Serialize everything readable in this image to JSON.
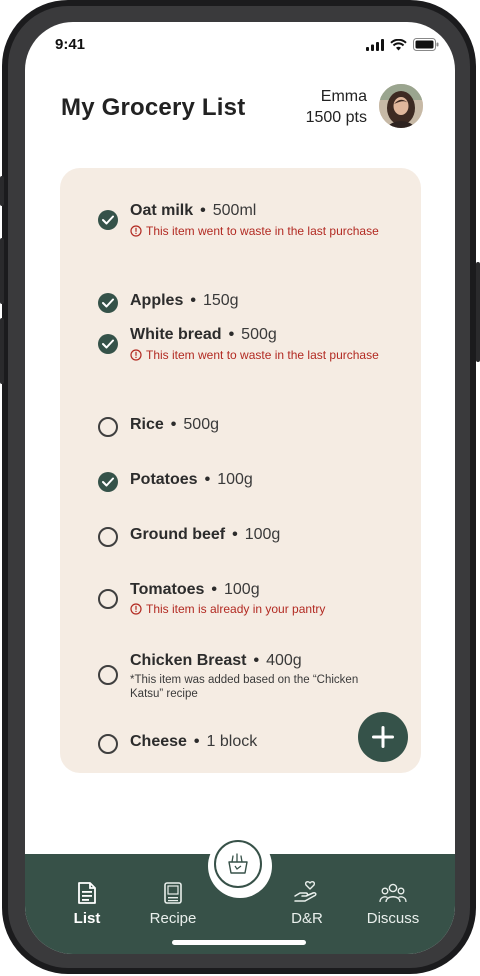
{
  "status": {
    "time": "9:41"
  },
  "header": {
    "title": "My Grocery List",
    "user_name": "Emma",
    "points": "1500 pts"
  },
  "list": {
    "items": [
      {
        "name": "Oat milk",
        "qty": "500ml",
        "checked": true,
        "warning": "This item went to waste in the last purchase"
      },
      {
        "name": "Apples",
        "qty": "150g",
        "checked": true
      },
      {
        "name": "White bread",
        "qty": "500g",
        "checked": true,
        "warning": "This item went to waste in the last purchase"
      },
      {
        "name": "Rice",
        "qty": "500g",
        "checked": false
      },
      {
        "name": "Potatoes",
        "qty": "100g",
        "checked": true
      },
      {
        "name": "Ground beef",
        "qty": "100g",
        "checked": false
      },
      {
        "name": "Tomatoes",
        "qty": "100g",
        "checked": false,
        "warning": "This item is already in your pantry"
      },
      {
        "name": "Chicken Breast",
        "qty": "400g",
        "checked": false,
        "note": "*This item was added based on the “Chicken Katsu” recipe"
      },
      {
        "name": "Cheese",
        "qty": "1 block",
        "checked": false
      }
    ],
    "bullet": "•"
  },
  "nav": {
    "items": [
      {
        "label": "List",
        "icon": "list-icon",
        "active": true
      },
      {
        "label": "Recipe",
        "icon": "recipe-book-icon",
        "active": false
      },
      {
        "label": "D&R",
        "icon": "donate-hand-heart-icon",
        "active": false
      },
      {
        "label": "Discuss",
        "icon": "people-group-icon",
        "active": false
      }
    ],
    "center_icon": "grocery-basket-icon"
  },
  "colors": {
    "accent": "#355249",
    "card": "#f5ece3",
    "warning": "#b22a22"
  }
}
